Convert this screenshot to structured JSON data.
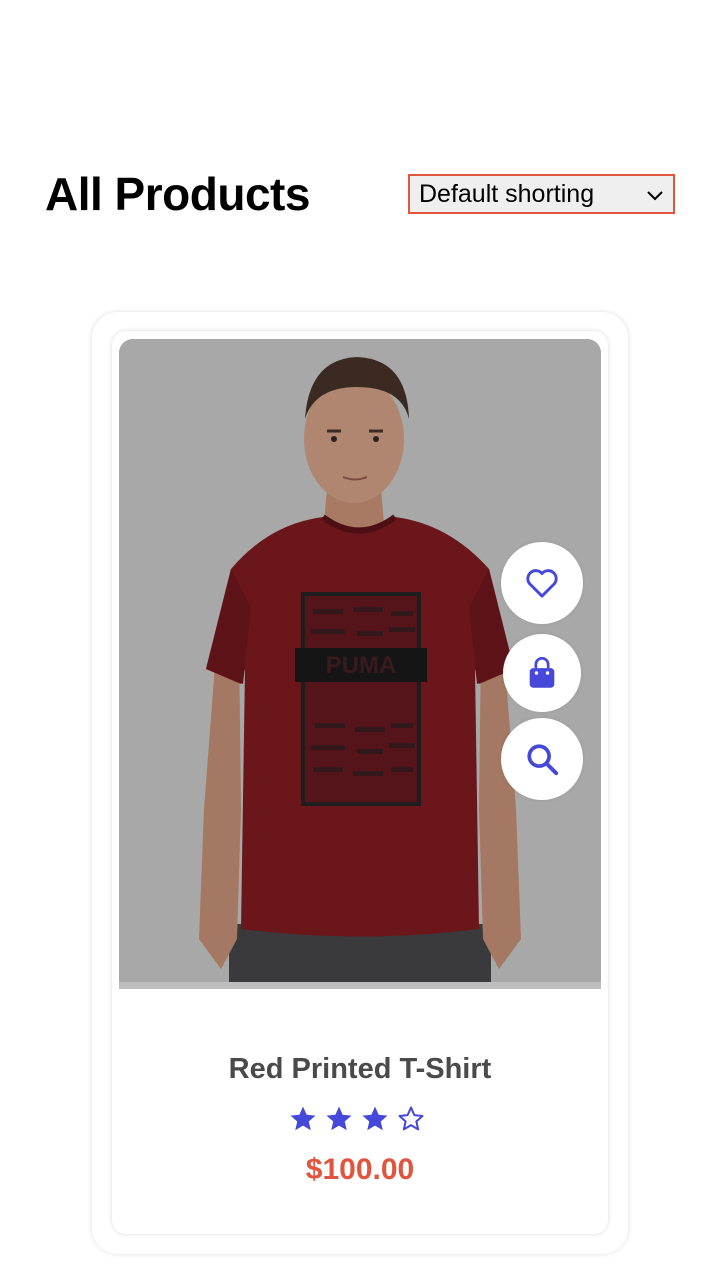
{
  "page": {
    "title": "All Products"
  },
  "sort": {
    "selected": "Default shorting",
    "border_color": "#e0553e"
  },
  "product": {
    "name": "Red Printed T-Shirt",
    "price": "$100.00",
    "rating": 3,
    "rating_max": 5,
    "image_subject": "man wearing red printed t-shirt",
    "print_text": "PUMA",
    "actions": [
      {
        "icon": "heart-icon"
      },
      {
        "icon": "shopping-bag-icon"
      },
      {
        "icon": "search-icon"
      }
    ]
  },
  "colors": {
    "accent": "#4548d9",
    "price": "#e0553e",
    "shirt": "#7a1a1e"
  }
}
